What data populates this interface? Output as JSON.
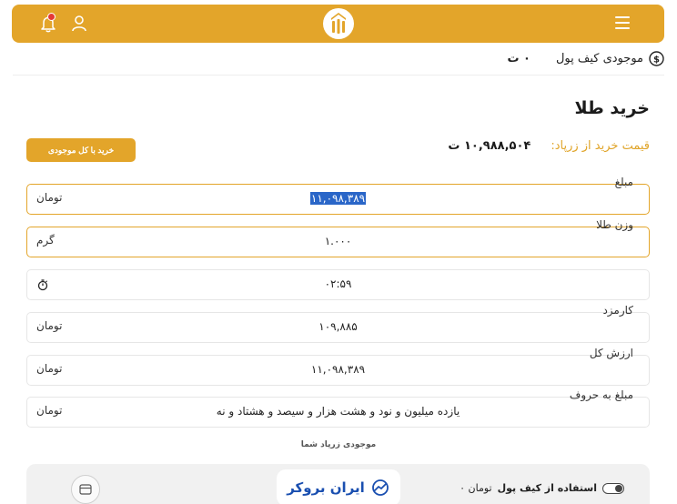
{
  "header": {
    "menu_icon": "hamburger-icon",
    "logo_icon": "brand-logo-icon",
    "user_icon": "user-icon",
    "bell_icon": "bell-icon",
    "badge": "0"
  },
  "wallet": {
    "label": "موجودی کیف پول",
    "value": "۰ ت",
    "icon": "dollar-coin-icon"
  },
  "page": {
    "title": "خرید طلا"
  },
  "price": {
    "label": "قیمت خرید از زرپاد:",
    "value": "۱۰,۹۸۸,۵۰۴ ت"
  },
  "buy_all_button": "خرید با کل موجودی",
  "fields": {
    "amount": {
      "label": "مبلغ",
      "value": "۱۱,۰۹۸,۳۸۹",
      "unit": "تومان"
    },
    "weight": {
      "label": "وزن طلا",
      "value": "۱.۰۰۰",
      "unit": "گرم"
    },
    "timer": {
      "value": "۰۲:۵۹",
      "icon": "stopwatch-icon"
    },
    "fee": {
      "label": "کارمزد",
      "value": "۱۰۹,۸۸۵",
      "unit": "تومان"
    },
    "total": {
      "label": "ارزش کل",
      "value": "۱۱,۰۹۸,۳۸۹",
      "unit": "تومان"
    },
    "words": {
      "label": "مبلغ به حروف",
      "value": "یازده میلیون و نود و هشت هزار و سیصد و هشتاد و نه",
      "unit": "تومان"
    }
  },
  "note": "موجودی زرپاد شما",
  "panel": {
    "brand_name": "ایران بروکر",
    "use_wallet_bold": "استفاده از کیف پول",
    "use_wallet_rest": "تومان ۰",
    "card_icon": "card-icon"
  },
  "colors": {
    "accent": "#e3a52a",
    "selection": "#2a66c8",
    "brand": "#1a4fb0"
  }
}
